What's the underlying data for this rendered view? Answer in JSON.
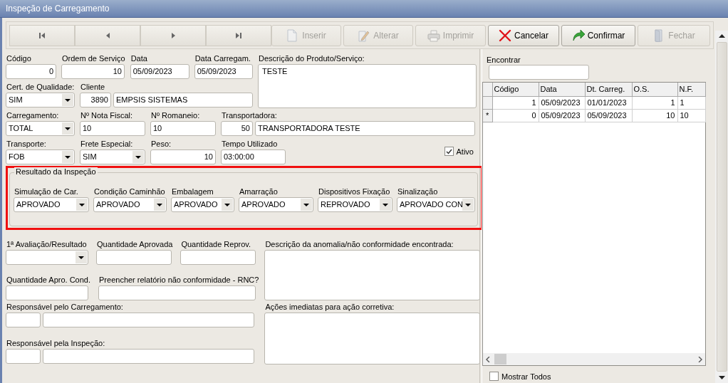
{
  "window": {
    "title": "Inspeção de Carregamento"
  },
  "toolbar": {
    "nav_buttons": [
      {
        "kind": "first",
        "disabled": false
      },
      {
        "kind": "prev",
        "disabled": false
      },
      {
        "kind": "next",
        "disabled": false
      },
      {
        "kind": "last",
        "disabled": false
      }
    ],
    "buttons": [
      {
        "kind": "insert",
        "label": "Inserir",
        "disabled": true
      },
      {
        "kind": "edit",
        "label": "Alterar",
        "disabled": true
      },
      {
        "kind": "print",
        "label": "Imprimir",
        "disabled": true
      },
      {
        "kind": "cancel",
        "label": "Cancelar",
        "disabled": false
      },
      {
        "kind": "confirm",
        "label": "Confirmar",
        "disabled": false
      },
      {
        "kind": "close",
        "label": "Fechar",
        "disabled": true
      }
    ]
  },
  "form": {
    "top_rows": [
      [
        {
          "kind": "number",
          "label": "Código",
          "value": "0"
        },
        {
          "kind": "number",
          "label": "Ordem de Serviço",
          "value": "10"
        },
        {
          "kind": "text",
          "label": "Data",
          "value": "05/09/2023"
        },
        {
          "kind": "text",
          "label": "Data Carregam.",
          "value": "05/09/2023"
        }
      ],
      [
        {
          "kind": "combo",
          "label": "Cert. de Qualidade:",
          "value": "SIM"
        },
        {
          "kind": "lookup",
          "label": "Cliente",
          "code": "3890",
          "value": "EMPSIS SISTEMAS"
        }
      ]
    ],
    "description": {
      "label": "Descrição do Produto/Serviço:",
      "value": "TESTE"
    },
    "rows": [
      [
        {
          "kind": "combo",
          "label": "Carregamento:",
          "value": "TOTAL"
        },
        {
          "kind": "text",
          "label": "Nº Nota Fiscal:",
          "value": "10"
        },
        {
          "kind": "text",
          "label": "Nº Romaneio:",
          "value": "10"
        },
        {
          "kind": "lookup",
          "label": "Transportadora:",
          "code": "50",
          "value": "TRANSPORTADORA TESTE"
        }
      ],
      [
        {
          "kind": "combo",
          "label": "Transporte:",
          "value": "FOB"
        },
        {
          "kind": "combo",
          "label": "Frete Especial:",
          "value": "SIM"
        },
        {
          "kind": "number",
          "label": "Peso:",
          "value": "10"
        },
        {
          "kind": "text",
          "label": "Tempo Utilizado",
          "value": "03:00:00"
        }
      ]
    ],
    "active": {
      "label": "Ativo",
      "checked": true
    },
    "inspection": {
      "title": "Resultado da Inspeção",
      "highlighted": true,
      "items": [
        {
          "label": "Simulação de Car.",
          "value": "APROVADO"
        },
        {
          "label": "Condição Caminhão",
          "value": "APROVADO"
        },
        {
          "label": "Embalagem",
          "value": "APROVADO"
        },
        {
          "label": "Amarração",
          "value": "APROVADO"
        },
        {
          "label": "Dispositivos Fixação",
          "value": "REPROVADO"
        },
        {
          "label": "Sinalização",
          "value": "APROVADO CON"
        }
      ]
    },
    "bottom_rows": [
      [
        {
          "kind": "combo",
          "label": "1ª Avaliação/Resultado"
        },
        {
          "kind": "text",
          "label": "Quantidade Aprovada"
        },
        {
          "kind": "text",
          "label": "Quantidade Reprov."
        }
      ],
      [
        {
          "kind": "text",
          "label": "Quantidade Apro. Cond."
        },
        {
          "kind": "text",
          "label": "Preencher relatório não conformidade - RNC?"
        }
      ],
      [
        {
          "kind": "lookup",
          "label": "Responsável pelo Carregamento:"
        }
      ],
      [
        {
          "kind": "lookup",
          "label": "Responsável pela Inspeção:"
        }
      ]
    ],
    "memos": [
      {
        "label": "Descrição da anomalia/não conformidade encontrada:"
      },
      {
        "label": "Ações imediatas para ação corretiva:"
      }
    ]
  },
  "search": {
    "label": "Encontrar"
  },
  "grid": {
    "columns": [
      "Código",
      "Data",
      "Dt. Carreg.",
      "O.S.",
      "N.F."
    ],
    "rows": [
      {
        "cells": [
          "1",
          "05/09/2023",
          "01/01/2023",
          "1",
          "1"
        ]
      },
      {
        "indicator": "*",
        "cells": [
          "0",
          "05/09/2023",
          "05/09/2023",
          "10",
          "10"
        ]
      }
    ]
  },
  "show_all": {
    "label": "Mostrar Todos",
    "checked": false
  }
}
